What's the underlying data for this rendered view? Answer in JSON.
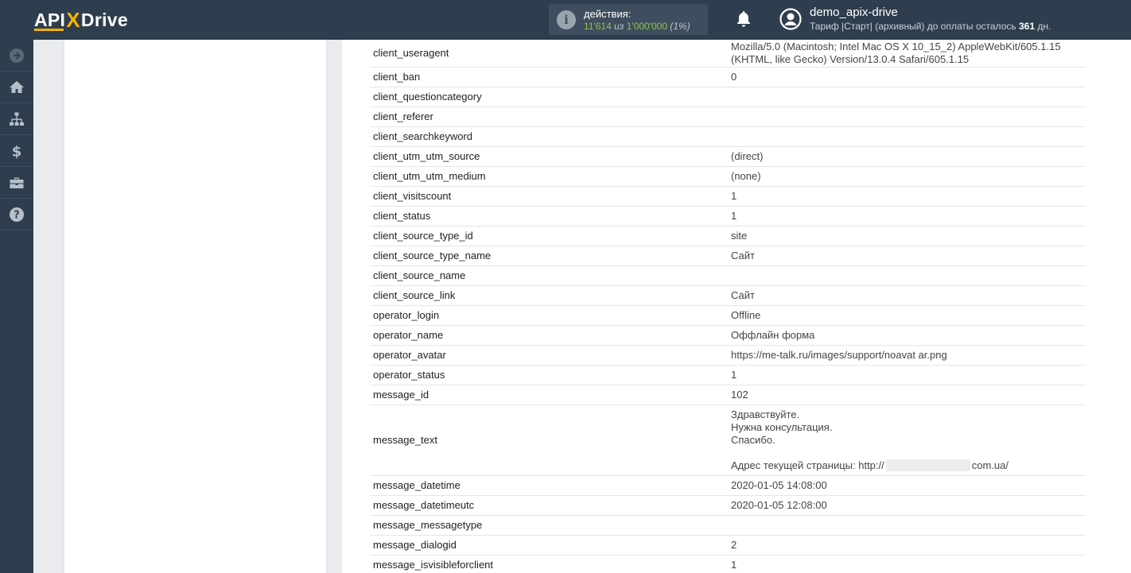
{
  "header": {
    "logo": {
      "part1": "API",
      "x": "X",
      "part2": "Drive"
    },
    "actions": {
      "label": "действия:",
      "used": "11'614",
      "of": "из",
      "total": "1'000'000",
      "percent": "(1%)"
    },
    "user": {
      "name": "demo_apix-drive",
      "tariff_prefix": "Тариф |Старт| (архивный) до оплаты осталось",
      "days": "361",
      "days_suffix": "дн."
    }
  },
  "sidebar": {
    "items": [
      {
        "icon": "arrow-right-circle-icon"
      },
      {
        "icon": "home-icon"
      },
      {
        "icon": "sitemap-icon"
      },
      {
        "icon": "dollar-icon"
      },
      {
        "icon": "briefcase-icon"
      },
      {
        "icon": "question-circle-icon"
      }
    ]
  },
  "colors": {
    "topbar": "#2f3e4e",
    "accent": "#f5b300",
    "green": "#8bc34a"
  },
  "rows": [
    {
      "key": "client_useragent",
      "v1": "Mozilla/5.0 (Macintosh; Intel Mac OS X 10_15_2) AppleWebKit/605.1.15",
      "v2": "(KHTML, like Gecko) Version/13.0.4 Safari/605.1.15"
    },
    {
      "key": "client_ban",
      "value": "0"
    },
    {
      "key": "client_questioncategory",
      "value": ""
    },
    {
      "key": "client_referer",
      "value": ""
    },
    {
      "key": "client_searchkeyword",
      "value": ""
    },
    {
      "key": "client_utm_utm_source",
      "value": "(direct)"
    },
    {
      "key": "client_utm_utm_medium",
      "value": "(none)"
    },
    {
      "key": "client_visitscount",
      "value": "1"
    },
    {
      "key": "client_status",
      "value": "1"
    },
    {
      "key": "client_source_type_id",
      "value": "site"
    },
    {
      "key": "client_source_type_name",
      "value": "Сайт"
    },
    {
      "key": "client_source_name",
      "value": ""
    },
    {
      "key": "client_source_link",
      "value": "Сайт"
    },
    {
      "key": "operator_login",
      "value": "Offline"
    },
    {
      "key": "operator_name",
      "value": "Оффлайн форма"
    },
    {
      "key": "operator_avatar",
      "value": "https://me-talk.ru/images/support/noavat ar.png"
    },
    {
      "key": "operator_status",
      "value": "1"
    },
    {
      "key": "message_id",
      "value": "102"
    },
    {
      "key": "message_text",
      "line1": "Здравствуйте.",
      "line2": "Нужна консультация.",
      "line3": "Спасибо.",
      "addr_prefix": "Адрес текущей страницы: http://",
      "addr_suffix": "com.ua/"
    },
    {
      "key": "message_datetime",
      "value": "2020-01-05 14:08:00"
    },
    {
      "key": "message_datetimeutc",
      "value": "2020-01-05 12:08:00"
    },
    {
      "key": "message_messagetype",
      "value": ""
    },
    {
      "key": "message_dialogid",
      "value": "2"
    },
    {
      "key": "message_isvisibleforclient",
      "value": "1"
    }
  ]
}
